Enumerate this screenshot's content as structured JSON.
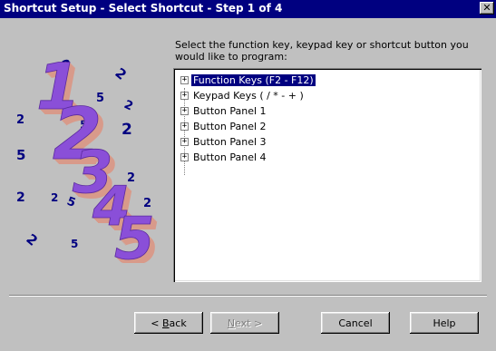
{
  "window": {
    "title": "Shortcut Setup - Select Shortcut - Step 1 of 4",
    "close_glyph": "✕"
  },
  "instructions": "Select the function key, keypad key or shortcut button you would like to program:",
  "tree": {
    "items": [
      {
        "label": "Function Keys (F2 - F12)",
        "expander": "+",
        "selected": true
      },
      {
        "label": "Keypad Keys ( / * - + )",
        "expander": "+",
        "selected": false
      },
      {
        "label": "Button Panel 1",
        "expander": "+",
        "selected": false
      },
      {
        "label": "Button Panel 2",
        "expander": "+",
        "selected": false
      },
      {
        "label": "Button Panel 3",
        "expander": "+",
        "selected": false
      },
      {
        "label": "Button Panel 4",
        "expander": "+",
        "selected": false
      }
    ]
  },
  "buttons": {
    "back": {
      "label_mnemonic": "B",
      "label_rest": "ack",
      "label_prefix": "< "
    },
    "next": {
      "label_mnemonic": "N",
      "label_rest": "ext >"
    },
    "cancel": {
      "label": "Cancel"
    },
    "help": {
      "label": "Help"
    }
  },
  "art": {
    "digits": [
      "1",
      "2",
      "3",
      "4",
      "5"
    ],
    "scatter": [
      "2",
      "2",
      "5",
      "2",
      "2",
      "5",
      "2",
      "5",
      "2",
      "2",
      "2",
      "5",
      "2",
      "2",
      "5"
    ],
    "colors": {
      "front": "#8a4fd8",
      "side": "#d89a8a",
      "small": "#000080",
      "title_bar": "#000080",
      "face": "#c0c0c0",
      "selection": "#000080"
    }
  }
}
